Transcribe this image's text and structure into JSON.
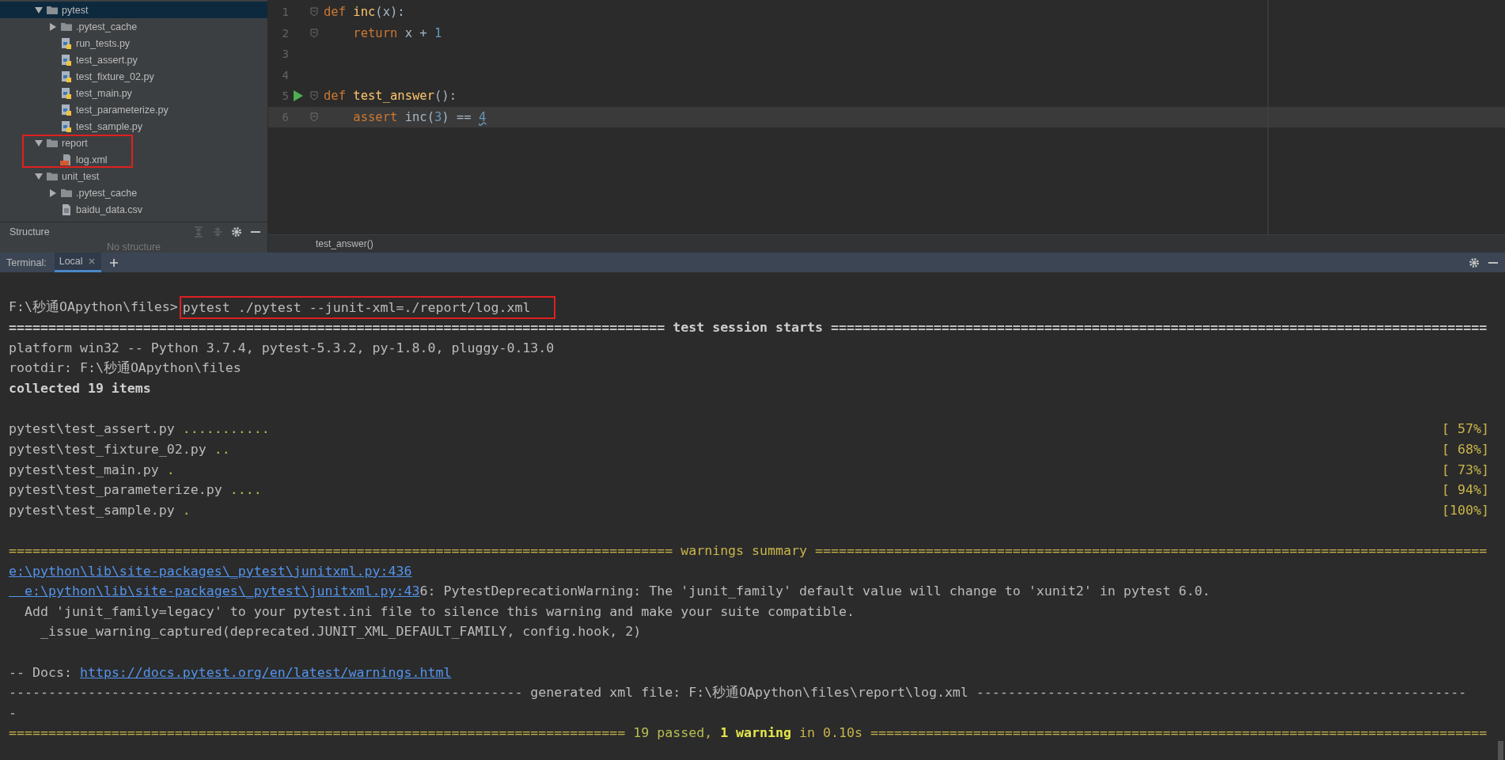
{
  "project_tree": [
    {
      "label": "pytest",
      "kind": "folder",
      "expanded": true,
      "selected": true,
      "highlighted": false,
      "children": [
        {
          "label": ".pytest_cache",
          "kind": "folder",
          "expanded": false,
          "selected": false,
          "highlighted": false
        },
        {
          "label": "run_tests.py",
          "kind": "python",
          "selected": false,
          "highlighted": false
        },
        {
          "label": "test_assert.py",
          "kind": "python",
          "selected": false,
          "highlighted": false
        },
        {
          "label": "test_fixture_02.py",
          "kind": "python",
          "selected": false,
          "highlighted": false
        },
        {
          "label": "test_main.py",
          "kind": "python",
          "selected": false,
          "highlighted": false
        },
        {
          "label": "test_parameterize.py",
          "kind": "python",
          "selected": false,
          "highlighted": false
        },
        {
          "label": "test_sample.py",
          "kind": "python",
          "selected": false,
          "highlighted": false
        }
      ]
    },
    {
      "label": "report",
      "kind": "folder",
      "expanded": true,
      "selected": false,
      "highlighted": true,
      "children": [
        {
          "label": "log.xml",
          "kind": "xml",
          "selected": false,
          "highlighted": false
        }
      ]
    },
    {
      "label": "unit_test",
      "kind": "folder",
      "expanded": true,
      "selected": false,
      "highlighted": false,
      "children": [
        {
          "label": ".pytest_cache",
          "kind": "folder",
          "expanded": false,
          "selected": false,
          "highlighted": false
        },
        {
          "label": "baidu_data.csv",
          "kind": "csv",
          "selected": false,
          "highlighted": false
        }
      ]
    }
  ],
  "structure_panel": {
    "title": "Structure",
    "empty_text": "No structure"
  },
  "editor": {
    "lines": [
      {
        "number": "1",
        "fold": true,
        "runnable": false,
        "current": false,
        "tokens": [
          {
            "text": "def",
            "kind": "kw"
          },
          {
            "text": " inc",
            "kind": "fn"
          },
          {
            "text": "(x):",
            "kind": "plain"
          }
        ]
      },
      {
        "number": "2",
        "fold": true,
        "runnable": false,
        "current": false,
        "tokens": [
          {
            "text": "    return",
            "kind": "kw"
          },
          {
            "text": " x + ",
            "kind": "plain"
          },
          {
            "text": "1",
            "kind": "num"
          }
        ]
      },
      {
        "number": "3",
        "fold": false,
        "runnable": false,
        "current": false
      },
      {
        "number": "4",
        "fold": false,
        "runnable": false,
        "current": false
      },
      {
        "number": "5",
        "fold": true,
        "runnable": true,
        "current": false,
        "tokens": [
          {
            "text": "def",
            "kind": "kw"
          },
          {
            "text": " test_answer",
            "kind": "fn"
          },
          {
            "text": "():",
            "kind": "plain"
          }
        ]
      },
      {
        "number": "6",
        "fold": true,
        "runnable": false,
        "current": true,
        "tokens": [
          {
            "text": "    assert",
            "kind": "kw"
          },
          {
            "text": " inc(",
            "kind": "plain"
          },
          {
            "text": "3",
            "kind": "num"
          },
          {
            "text": ") == ",
            "kind": "plain"
          },
          {
            "text": "4",
            "kind": "num-warn"
          }
        ]
      }
    ],
    "breadcrumb": "test_answer()"
  },
  "terminal": {
    "label": "Terminal:",
    "tabs": [
      {
        "label": "Local",
        "selected": true
      }
    ],
    "lines": [
      {
        "kind": "blank"
      },
      {
        "kind": "text",
        "segments": [
          {
            "text": "F:\\秒通OApython\\files>",
            "kind": "plain"
          },
          {
            "text": "pytest ./pytest --junit-xml=./report/log.xml",
            "kind": "boxed"
          }
        ]
      },
      {
        "kind": "text",
        "segments": [
          {
            "text": "=================================================================================== test session starts ===================================================================================",
            "kind": "bold"
          }
        ]
      },
      {
        "kind": "text",
        "segments": [
          {
            "text": "platform win32 -- Python 3.7.4, pytest-5.3.2, py-1.8.0, pluggy-0.13.0",
            "kind": "plain"
          }
        ]
      },
      {
        "kind": "text",
        "segments": [
          {
            "text": "rootdir: F:\\秒通OApython\\files",
            "kind": "plain"
          }
        ]
      },
      {
        "kind": "text",
        "segments": [
          {
            "text": "collected 19 items",
            "kind": "bold"
          }
        ]
      },
      {
        "kind": "blank"
      },
      {
        "kind": "text",
        "segments": [
          {
            "text": "pytest\\test_assert.py ",
            "kind": "plain"
          },
          {
            "text": "...........",
            "kind": "pass"
          }
        ],
        "progress": "[ 57%]"
      },
      {
        "kind": "text",
        "segments": [
          {
            "text": "pytest\\test_fixture_02.py ",
            "kind": "plain"
          },
          {
            "text": "..",
            "kind": "pass"
          }
        ],
        "progress": "[ 68%]"
      },
      {
        "kind": "text",
        "segments": [
          {
            "text": "pytest\\test_main.py ",
            "kind": "plain"
          },
          {
            "text": ".",
            "kind": "pass"
          }
        ],
        "progress": "[ 73%]"
      },
      {
        "kind": "text",
        "segments": [
          {
            "text": "pytest\\test_parameterize.py ",
            "kind": "plain"
          },
          {
            "text": "....",
            "kind": "pass"
          }
        ],
        "progress": "[ 94%]"
      },
      {
        "kind": "text",
        "segments": [
          {
            "text": "pytest\\test_sample.py ",
            "kind": "plain"
          },
          {
            "text": ".",
            "kind": "pass"
          }
        ],
        "progress": "[100%]"
      },
      {
        "kind": "blank"
      },
      {
        "kind": "text",
        "segments": [
          {
            "text": "==================================================================================== warnings summary =====================================================================================",
            "kind": "warn"
          }
        ]
      },
      {
        "kind": "text",
        "segments": [
          {
            "text": "e:\\python\\lib\\site-packages\\_pytest\\junitxml.py:436",
            "kind": "link"
          }
        ]
      },
      {
        "kind": "text",
        "segments": [
          {
            "text": "  e:\\python\\lib\\site-packages\\_pytest\\junitxml.py:43",
            "kind": "link"
          },
          {
            "text": "6: PytestDeprecationWarning: The 'junit_family' default value will change to 'xunit2' in pytest 6.0.",
            "kind": "plain"
          }
        ]
      },
      {
        "kind": "text",
        "segments": [
          {
            "text": "  Add 'junit_family=legacy' to your pytest.ini file to silence this warning and make your suite compatible.",
            "kind": "plain"
          }
        ]
      },
      {
        "kind": "text",
        "segments": [
          {
            "text": "    _issue_warning_captured(deprecated.JUNIT_XML_DEFAULT_FAMILY, config.hook, 2)",
            "kind": "plain"
          }
        ]
      },
      {
        "kind": "blank"
      },
      {
        "kind": "text",
        "segments": [
          {
            "text": "-- Docs: ",
            "kind": "plain"
          },
          {
            "text": "https://docs.pytest.org/en/latest/warnings.html",
            "kind": "link"
          }
        ]
      },
      {
        "kind": "text",
        "segments": [
          {
            "text": "----------------------------------------------------------------- generated xml file: F:\\秒通OApython\\files\\report\\log.xml --------------------------------------------------------------",
            "kind": "plain"
          }
        ]
      },
      {
        "kind": "text",
        "segments": [
          {
            "text": "-",
            "kind": "plain"
          }
        ]
      },
      {
        "kind": "text",
        "segments": [
          {
            "text": "============================================================================== ",
            "kind": "warn"
          },
          {
            "text": "19 passed",
            "kind": "pass"
          },
          {
            "text": ", ",
            "kind": "warn"
          },
          {
            "text": "1 warning",
            "kind": "warn-bold"
          },
          {
            "text": " in 0.10s ==============================================================================",
            "kind": "warn"
          }
        ]
      }
    ]
  }
}
